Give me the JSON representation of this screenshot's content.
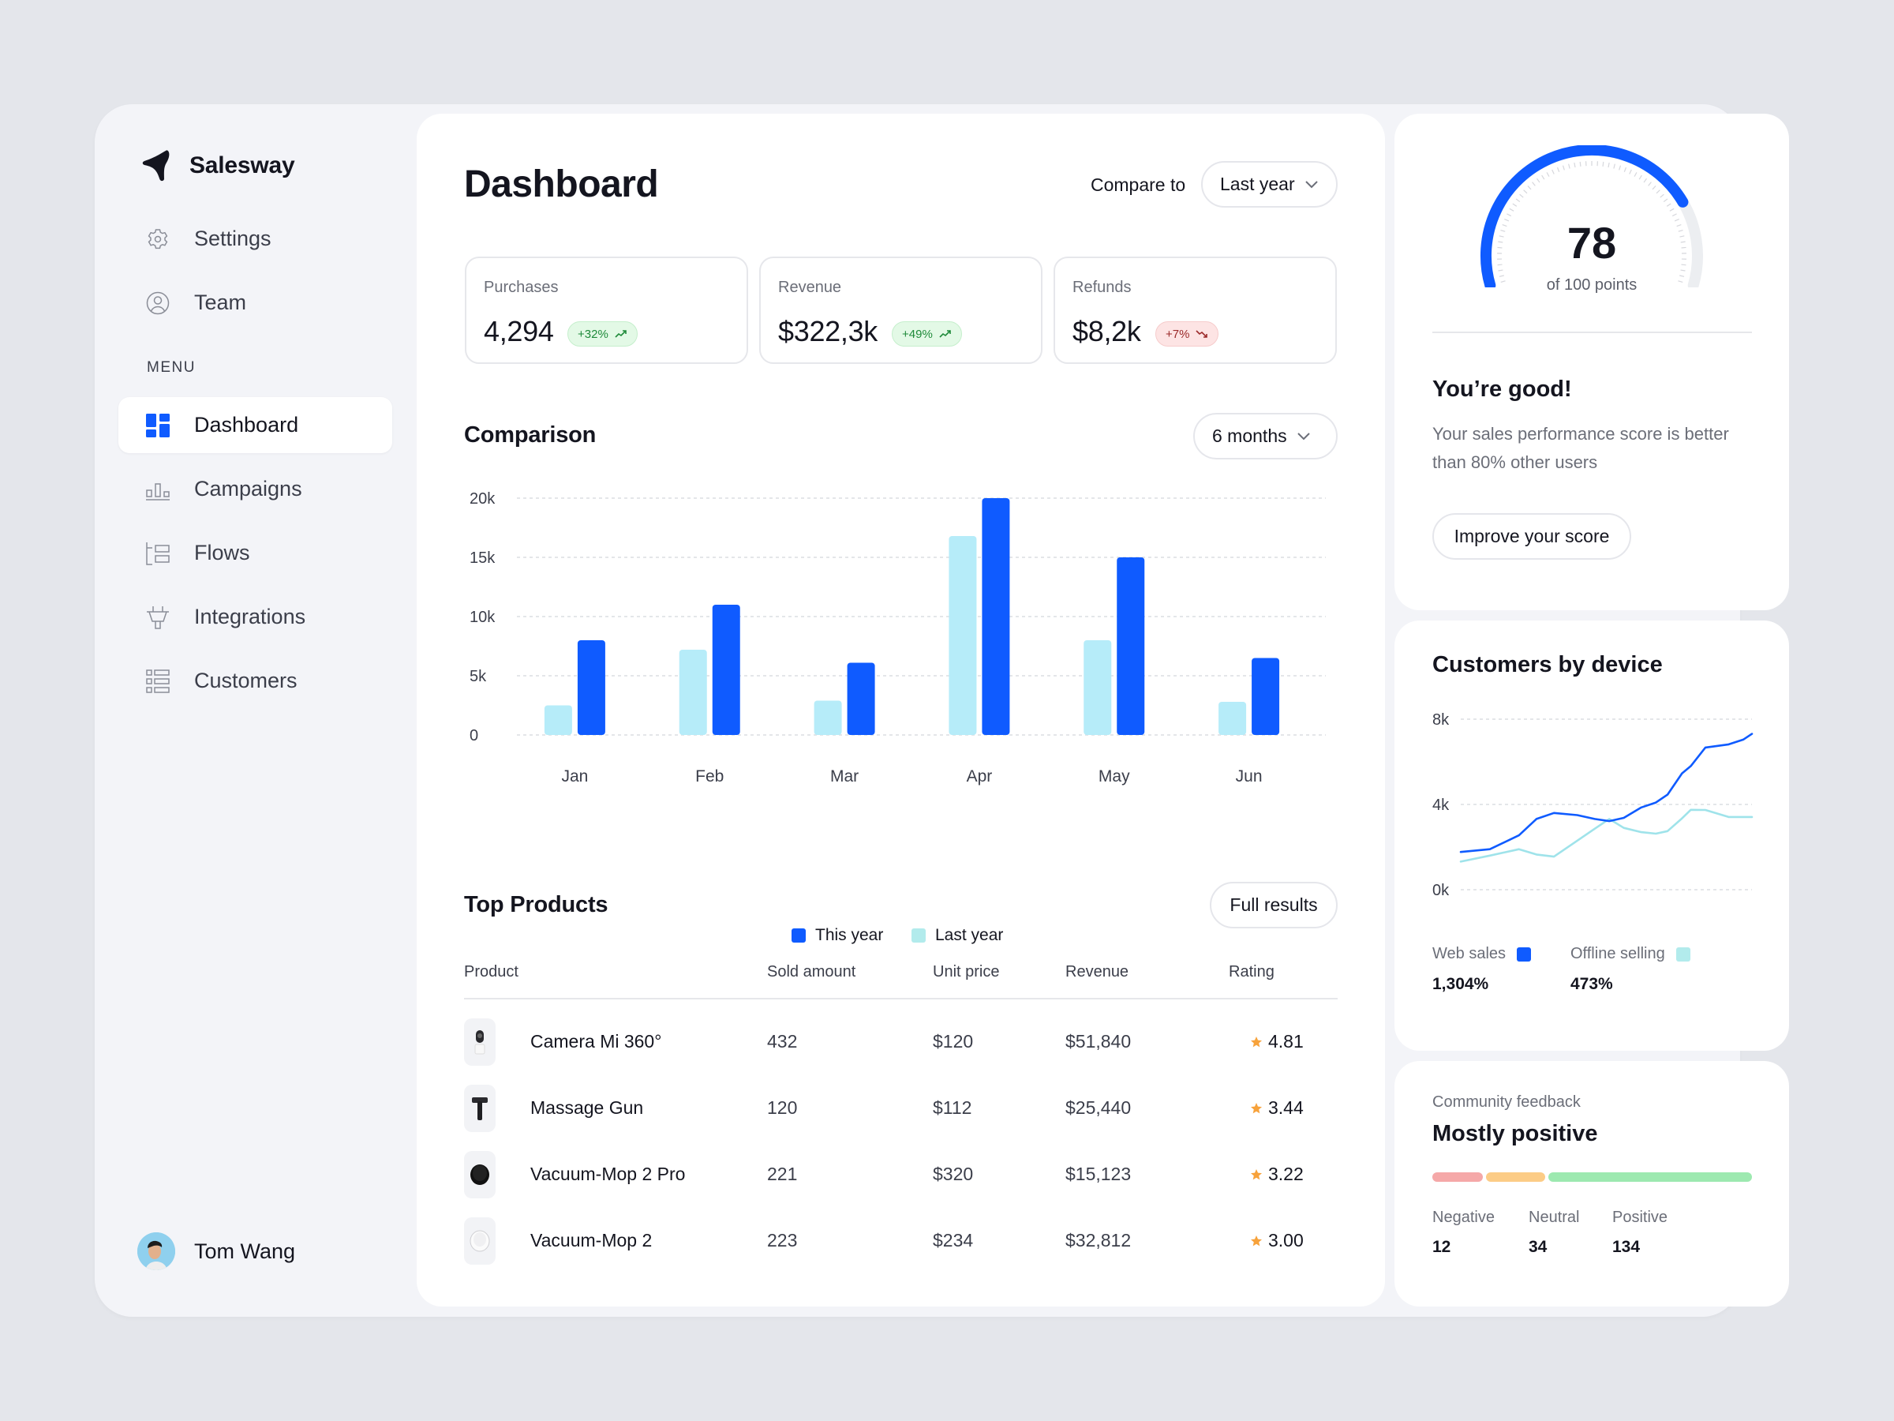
{
  "app": {
    "brand": "Salesway"
  },
  "colors": {
    "accent": "#0f5bff",
    "light_series": "#b6ecf9",
    "light_legend": "#b2ebec",
    "positive": "#1f8a3a",
    "negative": "#9b2a2a",
    "star": "#f7a23b",
    "feedback_negative": "#f5a8a8",
    "feedback_neutral": "#fccc86",
    "feedback_positive": "#9de9b0"
  },
  "sidebar": {
    "top_items": [
      {
        "label": "Settings",
        "icon": "gear-icon"
      },
      {
        "label": "Team",
        "icon": "user-circle-icon"
      }
    ],
    "menu_label": "MENU",
    "menu_items": [
      {
        "label": "Dashboard",
        "icon": "dashboard-grid-icon",
        "active": true
      },
      {
        "label": "Campaigns",
        "icon": "bar-chart-icon",
        "active": false
      },
      {
        "label": "Flows",
        "icon": "flows-icon",
        "active": false
      },
      {
        "label": "Integrations",
        "icon": "plug-icon",
        "active": false
      },
      {
        "label": "Customers",
        "icon": "list-icon",
        "active": false
      }
    ],
    "user": {
      "name": "Tom Wang"
    }
  },
  "header": {
    "title": "Dashboard",
    "compare_label": "Compare to",
    "compare_value": "Last year"
  },
  "stats": [
    {
      "label": "Purchases",
      "value": "4,294",
      "change": "+32%",
      "trend": "up"
    },
    {
      "label": "Revenue",
      "value": "$322,3k",
      "change": "+49%",
      "trend": "up"
    },
    {
      "label": "Refunds",
      "value": "$8,2k",
      "change": "+7%",
      "trend": "down"
    }
  ],
  "comparison": {
    "title": "Comparison",
    "range": "6 months"
  },
  "top_products": {
    "title": "Top Products",
    "full_results": "Full results",
    "columns": [
      "Product",
      "Sold amount",
      "Unit price",
      "Revenue",
      "Rating"
    ],
    "rows": [
      {
        "product": "Camera Mi 360°",
        "thumb": "camera",
        "sold": "432",
        "price": "$120",
        "revenue": "$51,840",
        "rating": "4.81"
      },
      {
        "product": "Massage Gun",
        "thumb": "massage-gun",
        "sold": "120",
        "price": "$112",
        "revenue": "$25,440",
        "rating": "3.44"
      },
      {
        "product": "Vacuum-Mop 2 Pro",
        "thumb": "vacuum-black",
        "sold": "221",
        "price": "$320",
        "revenue": "$15,123",
        "rating": "3.22"
      },
      {
        "product": "Vacuum-Mop 2",
        "thumb": "vacuum-white",
        "sold": "223",
        "price": "$234",
        "revenue": "$32,812",
        "rating": "3.00"
      }
    ]
  },
  "score": {
    "value": "78",
    "max": 100,
    "fraction": 0.78,
    "subtitle": "of 100 points",
    "title": "You’re good!",
    "text": "Your sales performance score is better than 80% other users",
    "button": "Improve your score"
  },
  "customers_by_device": {
    "title": "Customers by device",
    "legend": [
      {
        "label": "Web sales",
        "value": "1,304%"
      },
      {
        "label": "Offline selling",
        "value": "473%"
      }
    ]
  },
  "feedback": {
    "label": "Community feedback",
    "title": "Mostly positive",
    "categories": [
      {
        "label": "Negative",
        "value": "12",
        "count": 12
      },
      {
        "label": "Neutral",
        "value": "34",
        "count": 34
      },
      {
        "label": "Positive",
        "value": "134",
        "count": 134
      }
    ]
  },
  "chart_data": [
    {
      "type": "bar",
      "title": "Comparison",
      "categories": [
        "Jan",
        "Feb",
        "Mar",
        "Apr",
        "May",
        "Jun"
      ],
      "series": [
        {
          "name": "Last year",
          "values": [
            2.5,
            7.2,
            2.9,
            16.8,
            8.0,
            2.8
          ]
        },
        {
          "name": "This year",
          "values": [
            8.0,
            11.0,
            6.1,
            20.0,
            15.0,
            6.5
          ]
        }
      ],
      "yticks": [
        "0",
        "5k",
        "10k",
        "15k",
        "20k"
      ],
      "ytick_values": [
        0,
        5,
        10,
        15,
        20
      ],
      "ylim": [
        0,
        20
      ],
      "yunit": "thousands",
      "xlabel": "",
      "ylabel": "",
      "grid": true,
      "legend": [
        "This year",
        "Last year"
      ],
      "legend_position": "bottom-center"
    },
    {
      "type": "line",
      "title": "Customers by device",
      "x": [
        0,
        0.1,
        0.2,
        0.26,
        0.32,
        0.4,
        0.46,
        0.51,
        0.56,
        0.62,
        0.67,
        0.71,
        0.76,
        0.79,
        0.84,
        0.92,
        0.97,
        1.0
      ],
      "series": [
        {
          "name": "Web sales",
          "values": [
            1.77,
            1.9,
            2.55,
            3.32,
            3.6,
            3.5,
            3.32,
            3.22,
            3.37,
            3.86,
            4.09,
            4.46,
            5.46,
            5.8,
            6.67,
            6.82,
            7.04,
            7.31
          ]
        },
        {
          "name": "Offline selling",
          "values": [
            1.32,
            1.6,
            1.9,
            1.65,
            1.55,
            2.3,
            2.86,
            3.32,
            2.9,
            2.7,
            2.63,
            2.75,
            3.35,
            3.75,
            3.74,
            3.41,
            3.41,
            3.41
          ]
        }
      ],
      "yticks": [
        "0k",
        "4k",
        "8k"
      ],
      "ytick_values": [
        0,
        4,
        8
      ],
      "ylim": [
        0,
        8
      ],
      "yunit": "thousands",
      "grid": true,
      "legend_position": "bottom"
    }
  ]
}
